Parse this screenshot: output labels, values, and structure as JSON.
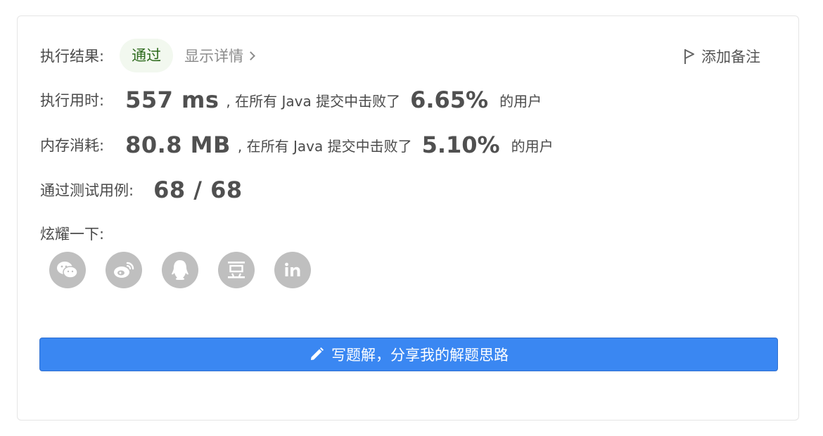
{
  "result": {
    "label": "执行结果:",
    "status": "通过",
    "details_link": "显示详情"
  },
  "add_note": "添加备注",
  "runtime": {
    "label": "执行用时:",
    "value": "557 ms",
    "beat_prefix": ", 在所有 Java 提交中击败了",
    "percent": "6.65%",
    "suffix": "的用户"
  },
  "memory": {
    "label": "内存消耗:",
    "value": "80.8 MB",
    "beat_prefix": ", 在所有 Java 提交中击败了",
    "percent": "5.10%",
    "suffix": "的用户"
  },
  "tests": {
    "label": "通过测试用例:",
    "value": "68 / 68"
  },
  "share": {
    "label": "炫耀一下:",
    "icons": [
      "wechat-icon",
      "weibo-icon",
      "qq-icon",
      "douban-icon",
      "linkedin-icon"
    ]
  },
  "write_solution": "写题解，分享我的解题思路",
  "colors": {
    "accent": "#3a87f2",
    "success_bg": "#f2f8ef",
    "success_text": "#2e6b1e",
    "icon_bg": "#bfbfbf"
  }
}
